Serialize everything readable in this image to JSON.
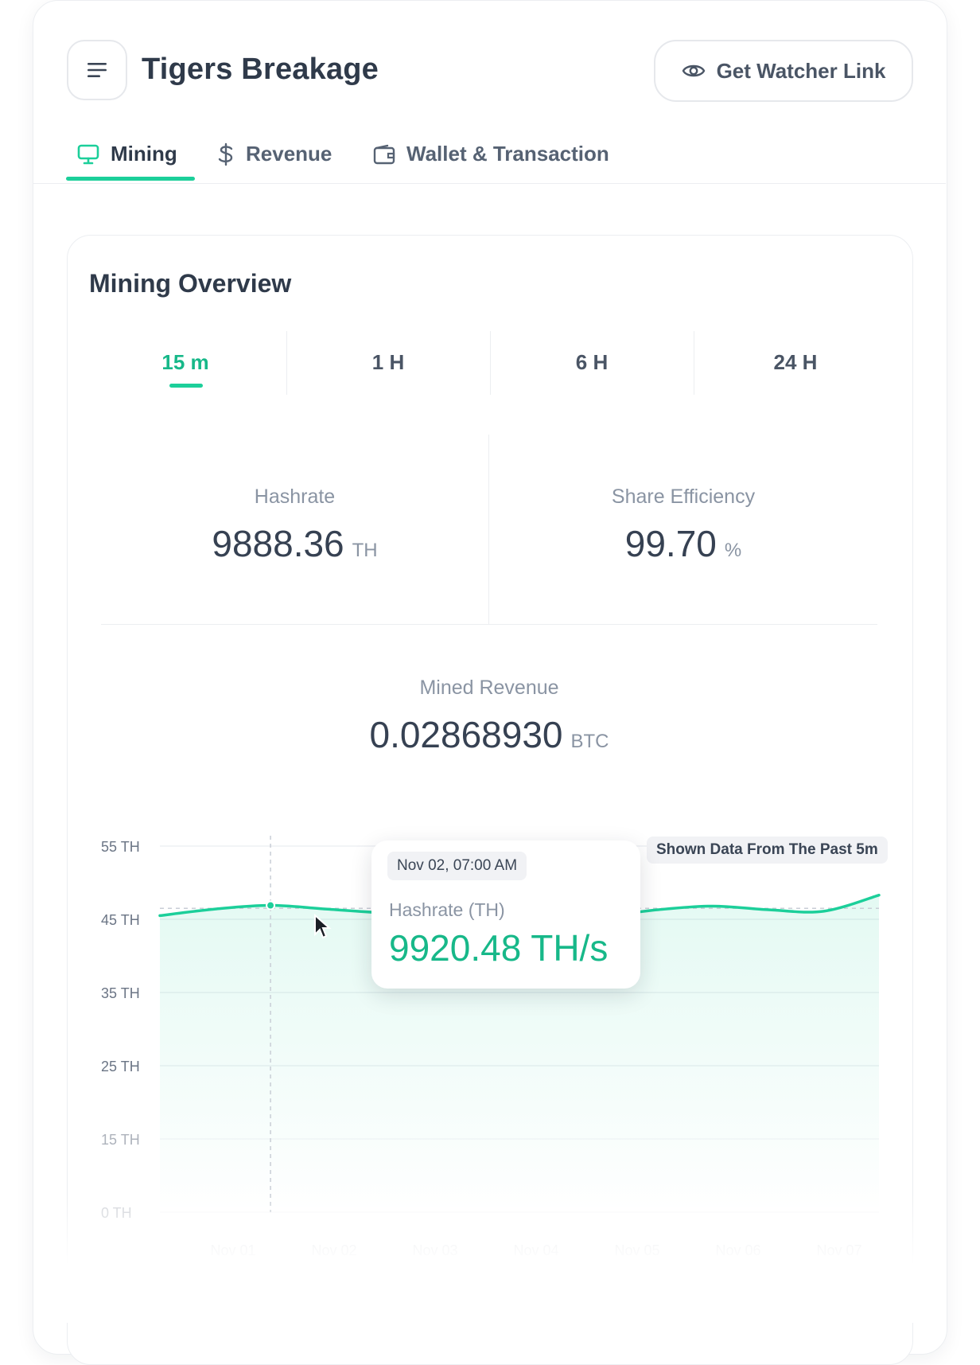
{
  "header": {
    "title": "Tigers Breakage",
    "watcher_button": "Get Watcher Link"
  },
  "tabs": [
    {
      "label": "Mining",
      "icon": "monitor-icon",
      "active": true
    },
    {
      "label": "Revenue",
      "icon": "dollar-icon",
      "active": false
    },
    {
      "label": "Wallet & Transaction",
      "icon": "wallet-icon",
      "active": false
    }
  ],
  "overview": {
    "title": "Mining Overview",
    "ranges": [
      "15 m",
      "1 H",
      "6 H",
      "24 H"
    ],
    "selected_range": "15 m",
    "hashrate": {
      "label": "Hashrate",
      "value": "9888.36",
      "unit": "TH"
    },
    "efficiency": {
      "label": "Share Efficiency",
      "value": "99.70",
      "unit": "%"
    },
    "revenue": {
      "label": "Mined Revenue",
      "value": "0.02868930",
      "unit": "BTC"
    }
  },
  "tooltip": {
    "date": "Nov 02, 07:00 AM",
    "label": "Hashrate (TH)",
    "value": "9920.48 TH/s"
  },
  "shown_badge": "Shown Data From The Past 5m",
  "colors": {
    "accent": "#1ccf9a",
    "accent_text": "#17b889",
    "text": "#2f3a4a",
    "muted": "#8a94a3"
  },
  "chart_data": {
    "type": "area",
    "y_ticks": [
      "55 TH",
      "45 TH",
      "35 TH",
      "25 TH",
      "15 TH",
      "0 TH"
    ],
    "x_ticks": [
      "Nov 01",
      "Nov 02",
      "Nov 03",
      "Nov 04",
      "Nov 05",
      "Nov 06",
      "Nov 07"
    ],
    "ylim": [
      0,
      55
    ],
    "reference_line": 46.5,
    "series": [
      {
        "values": [
          45.5,
          46.4,
          46.9,
          46.4,
          45.9,
          45.6,
          45.2,
          44.9,
          45.4,
          46.3,
          46.8,
          46.3,
          46.1,
          48.3
        ]
      }
    ],
    "highlight_index": 2,
    "grid": true
  }
}
